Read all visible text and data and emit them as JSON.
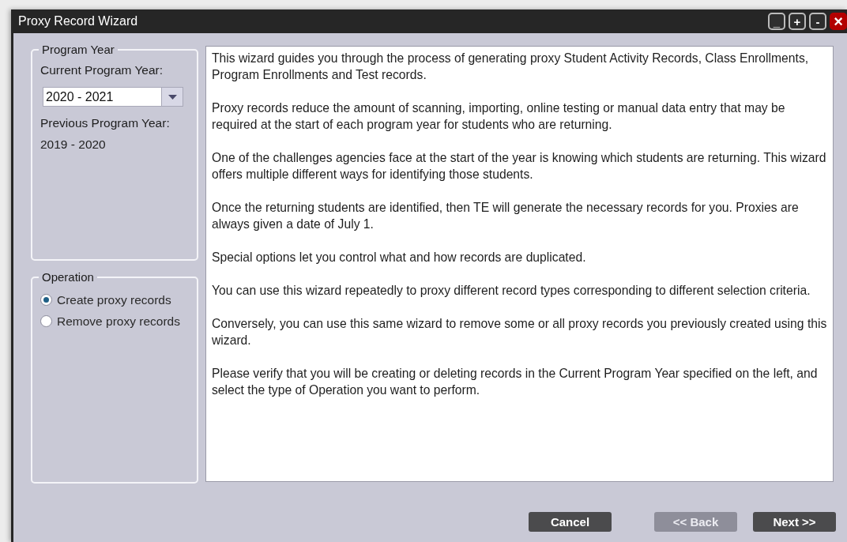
{
  "window": {
    "title": "Proxy Record Wizard",
    "controls": [
      "_",
      "+",
      "-",
      "×"
    ]
  },
  "program_year": {
    "legend": "Program Year",
    "current_label": "Current Program Year:",
    "current_value": "2020 - 2021",
    "previous_label": "Previous Program Year:",
    "previous_value": "2019 - 2020"
  },
  "operation": {
    "legend": "Operation",
    "options": [
      {
        "label": "Create proxy records",
        "selected": true
      },
      {
        "label": "Remove proxy records",
        "selected": false
      }
    ]
  },
  "description": [
    "This wizard guides you through the process of generating proxy Student Activity Records, Class Enrollments, Program Enrollments and Test records.",
    "Proxy records reduce the amount of scanning, importing, online testing or manual data entry that may be required at the start of each program year for students who are returning.",
    "One of the challenges agencies face at the start of the year is knowing which students are returning. This wizard offers multiple different ways for identifying those students.",
    "Once the returning students are identified, then TE will generate the necessary records for you. Proxies are always given a date of July 1.",
    "Special options let you control what and how records are duplicated.",
    "You can use this wizard repeatedly to proxy different record types corresponding to different selection criteria.",
    "Conversely, you can use this same wizard to remove some or all proxy records you previously created using this wizard.",
    "Please verify that you will be creating or deleting records in the Current Program Year specified on the left, and select the type of Operation you want to perform."
  ],
  "buttons": [
    {
      "label": "Cancel",
      "disabled": false
    },
    {
      "label": "<< Back",
      "disabled": true
    },
    {
      "label": "Next >>",
      "disabled": false
    }
  ]
}
